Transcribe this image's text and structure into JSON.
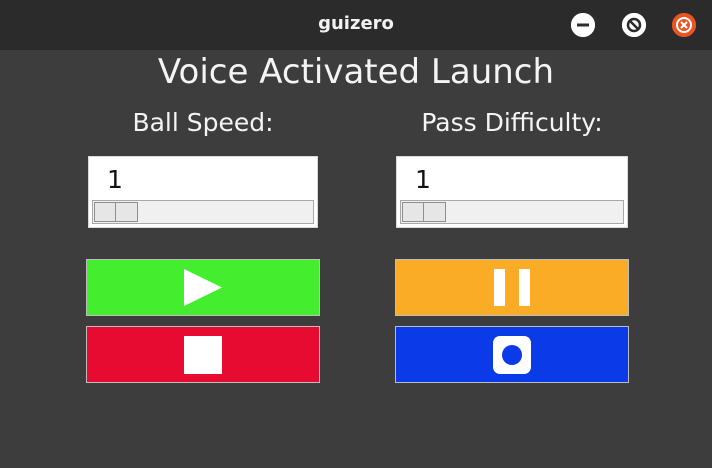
{
  "window": {
    "title": "guizero",
    "controls": [
      "minimize-icon",
      "maximize-icon",
      "close-icon"
    ],
    "close_color": "#e95420"
  },
  "app": {
    "title": "Voice Activated Launch"
  },
  "ball_speed": {
    "label": "Ball Speed:",
    "value": "1"
  },
  "pass_difficulty": {
    "label": "Pass Difficulty:",
    "value": "1"
  },
  "buttons": {
    "play": {
      "icon": "play-icon",
      "color": "#44ee2e"
    },
    "pause": {
      "icon": "pause-icon",
      "color": "#fbac26"
    },
    "stop": {
      "icon": "stop-icon",
      "color": "#e70b31"
    },
    "record": {
      "icon": "record-icon",
      "color": "#0b3ae9"
    }
  }
}
